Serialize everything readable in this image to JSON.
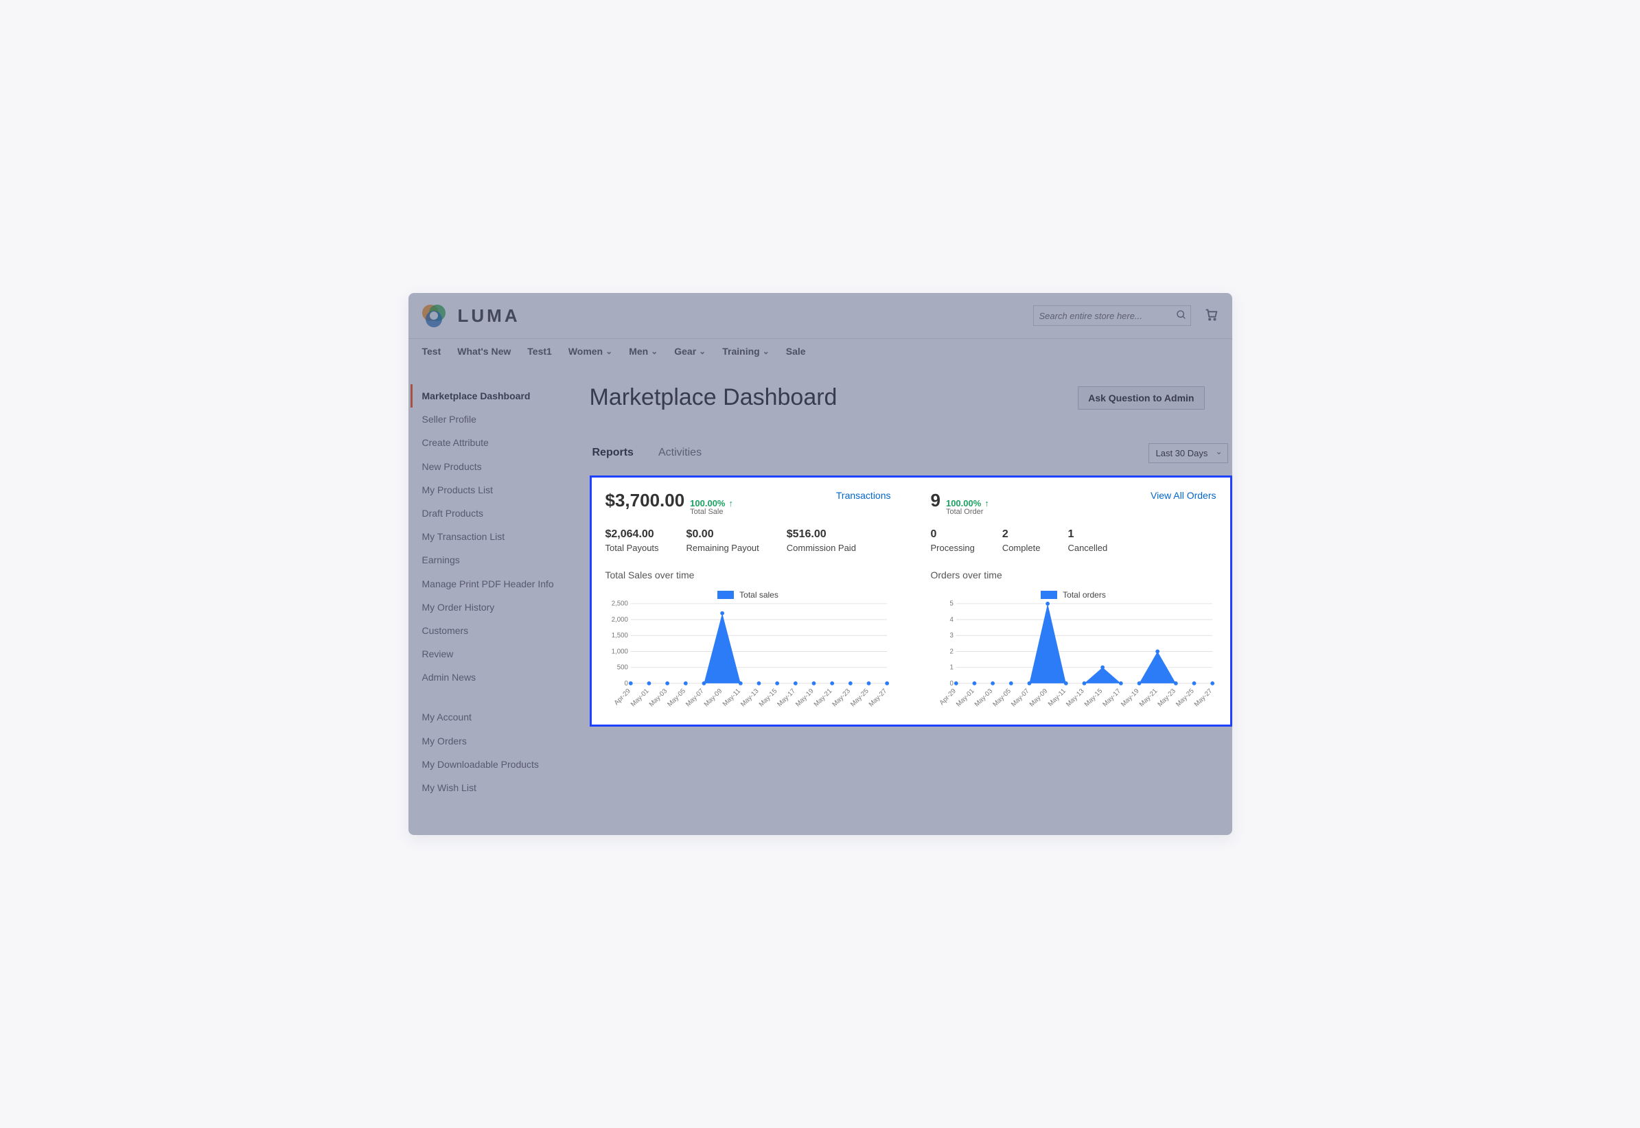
{
  "brand": "LUMA",
  "search": {
    "placeholder": "Search entire store here..."
  },
  "topnav": [
    "Test",
    "What's New",
    "Test1",
    "Women",
    "Men",
    "Gear",
    "Training",
    "Sale"
  ],
  "topnav_has_chevron": [
    false,
    false,
    false,
    true,
    true,
    true,
    true,
    false
  ],
  "sidebar": {
    "items": [
      "Marketplace Dashboard",
      "Seller Profile",
      "Create Attribute",
      "New Products",
      "My Products List",
      "Draft Products",
      "My Transaction List",
      "Earnings",
      "Manage Print PDF Header Info",
      "My Order History",
      "Customers",
      "Review",
      "Admin News"
    ],
    "items2": [
      "My Account",
      "My Orders",
      "My Downloadable Products",
      "My Wish List"
    ],
    "active_index": 0
  },
  "page": {
    "title": "Marketplace Dashboard",
    "ask_button": "Ask Question to Admin",
    "tabs": [
      "Reports",
      "Activities"
    ],
    "active_tab_index": 0,
    "range": "Last 30 Days"
  },
  "sales_panel": {
    "total_sale": "$3,700.00",
    "delta": "100.00%",
    "delta_label": "Total Sale",
    "link": "Transactions",
    "stats": [
      {
        "value": "$2,064.00",
        "label": "Total Payouts"
      },
      {
        "value": "$0.00",
        "label": "Remaining Payout"
      },
      {
        "value": "$516.00",
        "label": "Commission Paid"
      }
    ],
    "chart_title": "Total Sales over time",
    "legend": "Total sales"
  },
  "orders_panel": {
    "total_orders": "9",
    "delta": "100.00%",
    "delta_label": "Total Order",
    "link": "View All Orders",
    "stats": [
      {
        "value": "0",
        "label": "Processing"
      },
      {
        "value": "2",
        "label": "Complete"
      },
      {
        "value": "1",
        "label": "Cancelled"
      }
    ],
    "chart_title": "Orders over time",
    "legend": "Total orders"
  },
  "chart_data": [
    {
      "type": "area",
      "title": "Total Sales over time",
      "xlabel": "",
      "ylabel": "",
      "ylim": [
        0,
        2500
      ],
      "y_ticks": [
        0,
        500,
        1000,
        1500,
        2000,
        2500
      ],
      "categories": [
        "Apr-29",
        "May-01",
        "May-03",
        "May-05",
        "May-07",
        "May-09",
        "May-11",
        "May-13",
        "May-15",
        "May-17",
        "May-19",
        "May-21",
        "May-23",
        "May-25",
        "May-27"
      ],
      "series": [
        {
          "name": "Total sales",
          "values": [
            0,
            0,
            0,
            0,
            0,
            2200,
            0,
            0,
            0,
            0,
            0,
            0,
            0,
            0,
            0
          ]
        }
      ]
    },
    {
      "type": "area",
      "title": "Orders over time",
      "xlabel": "",
      "ylabel": "",
      "ylim": [
        0,
        5
      ],
      "y_ticks": [
        0,
        1,
        2,
        3,
        4,
        5
      ],
      "categories": [
        "Apr-29",
        "May-01",
        "May-03",
        "May-05",
        "May-07",
        "May-09",
        "May-11",
        "May-13",
        "May-15",
        "May-17",
        "May-19",
        "May-21",
        "May-23",
        "May-25",
        "May-27"
      ],
      "series": [
        {
          "name": "Total orders",
          "values": [
            0,
            0,
            0,
            0,
            0,
            5,
            0,
            0,
            1,
            0,
            0,
            2,
            0,
            0,
            0
          ]
        }
      ]
    }
  ]
}
